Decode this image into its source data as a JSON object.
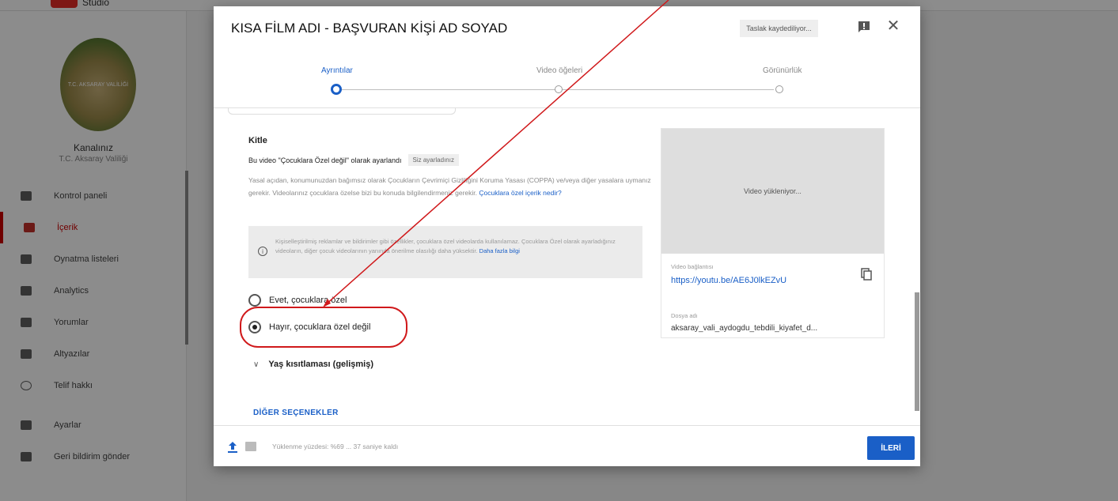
{
  "app": {
    "logo_text": "Studio",
    "channel": {
      "title": "Kanalınız",
      "subtitle": "T.C. Aksaray Valiliği",
      "emblem_text": "T.C. AKSARAY VALİLİĞİ"
    },
    "nav": [
      {
        "label": "Kontrol paneli",
        "icon": "dashboard-icon"
      },
      {
        "label": "İçerik",
        "icon": "video-content-icon",
        "active": true
      },
      {
        "label": "Oynatma listeleri",
        "icon": "playlist-icon"
      },
      {
        "label": "Analytics",
        "icon": "analytics-icon"
      },
      {
        "label": "Yorumlar",
        "icon": "comments-icon"
      },
      {
        "label": "Altyazılar",
        "icon": "subtitles-icon"
      },
      {
        "label": "Telif hakkı",
        "icon": "copyright-icon"
      },
      {
        "label": "Ayarlar",
        "icon": "settings-icon"
      },
      {
        "label": "Geri bildirim gönder",
        "icon": "feedback-icon"
      }
    ]
  },
  "dialog": {
    "title": "KISA FİLM ADI - BAŞVURAN KİŞİ AD SOYAD",
    "draft_status": "Taslak kaydediliyor...",
    "steps": [
      {
        "label": "Ayrıntılar",
        "active": true
      },
      {
        "label": "Video öğeleri",
        "active": false
      },
      {
        "label": "Görünürlük",
        "active": false
      }
    ],
    "audience": {
      "title": "Kitle",
      "status_text": "Bu video \"Çocuklara Özel değil\" olarak ayarlandı",
      "status_chip": "Siz ayarladınız",
      "legal_text": "Yasal açıdan, konumunuzdan bağımsız olarak Çocukların Çevrimiçi Gizliliğini Koruma Yasası (COPPA) ve/veya diğer yasalara uymanız gerekir. Videolarınız çocuklara özelse bizi bu konuda bilgilendirmeniz gerekir.",
      "legal_link": "Çocuklara özel içerik nedir?",
      "info_text": "Kişiselleştirilmiş reklamlar ve bildirimler gibi özellikler, çocuklara özel videolarda kullanılamaz. Çocuklara Özel olarak ayarladığınız videoların, diğer çocuk videolarının yanında önerilme olasılığı daha yüksektir.",
      "info_link": "Daha fazla bilgi",
      "option_yes": "Evet, çocuklara özel",
      "option_no": "Hayır, çocuklara özel değil",
      "age_restriction": "Yaş kısıtlaması (gelişmiş)",
      "more_options": "DİĞER SEÇENEKLER"
    },
    "preview": {
      "uploading_text": "Video yükleniyor...",
      "link_label": "Video bağlantısı",
      "link": "https://youtu.be/AE6J0lkEZvU",
      "file_label": "Dosya adı",
      "file_name": "aksaray_vali_aydogdu_tebdili_kiyafet_d..."
    },
    "footer": {
      "status": "Yüklenme yüzdesi: %69 ... 37 saniye kaldı",
      "next_button": "İLERİ"
    }
  },
  "colors": {
    "accent": "#1a5fc7",
    "annotation": "#d0191b"
  }
}
